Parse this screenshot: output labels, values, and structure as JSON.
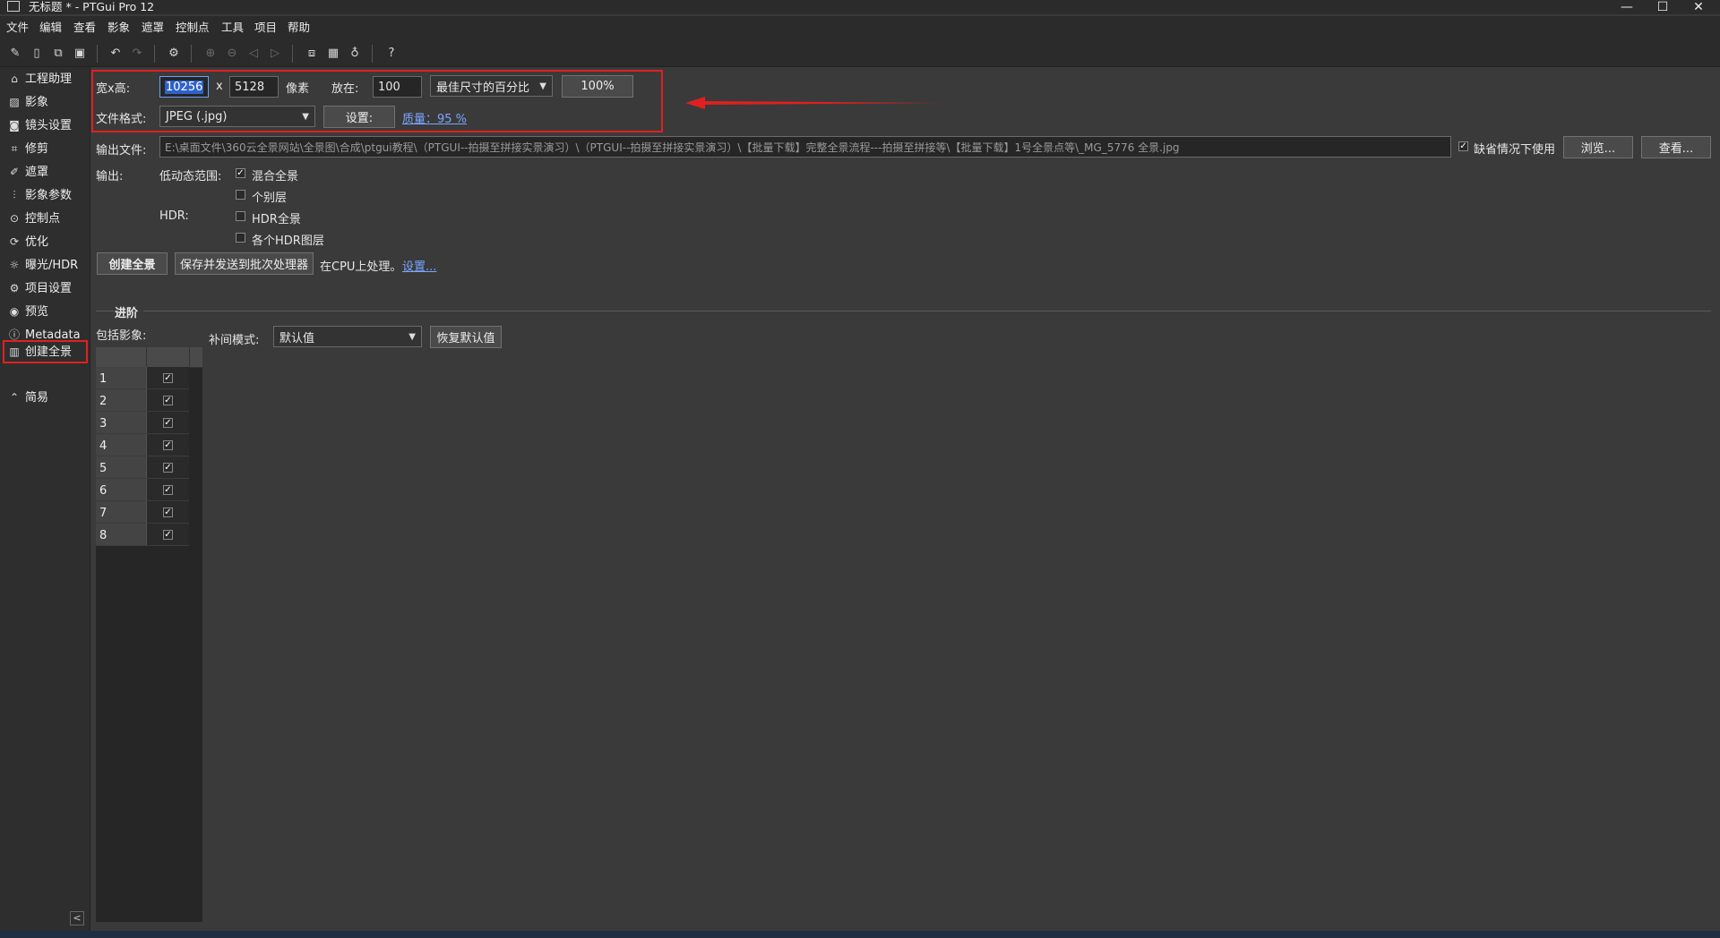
{
  "window": {
    "title": "无标题 * - PTGui Pro 12",
    "controls": {
      "minimize": "—",
      "maximize": "☐",
      "close": "✕"
    }
  },
  "menu": [
    "文件",
    "编辑",
    "查看",
    "影象",
    "遮罩",
    "控制点",
    "工具",
    "项目",
    "帮助"
  ],
  "toolbar": {
    "icons": [
      "new-project-icon",
      "open-icon",
      "copy-icon",
      "save-icon",
      "undo-icon",
      "redo-icon",
      "settings-icon",
      "zoom-in-icon",
      "zoom-out-icon",
      "prev-icon",
      "next-icon",
      "panorama-editor-icon",
      "table-icon",
      "light-icon",
      "help-icon"
    ]
  },
  "sidebar": {
    "items": [
      {
        "label": "工程助理",
        "icon": "home-icon"
      },
      {
        "label": "影象",
        "icon": "image-icon"
      },
      {
        "label": "镜头设置",
        "icon": "camera-icon"
      },
      {
        "label": "修剪",
        "icon": "crop-icon"
      },
      {
        "label": "遮罩",
        "icon": "brush-icon"
      },
      {
        "label": "影象参数",
        "icon": "sliders-icon"
      },
      {
        "label": "控制点",
        "icon": "control-point-icon"
      },
      {
        "label": "优化",
        "icon": "optimize-icon"
      },
      {
        "label": "曝光/HDR",
        "icon": "sun-icon"
      },
      {
        "label": "项目设置",
        "icon": "gear-icon"
      },
      {
        "label": "预览",
        "icon": "eye-icon"
      },
      {
        "label": "Metadata",
        "icon": "info-icon"
      },
      {
        "label": "创建全景",
        "icon": "panorama-icon"
      }
    ],
    "simple_label": "简易",
    "active": "创建全景"
  },
  "size": {
    "label": "宽x高:",
    "width": "10256",
    "x": "x",
    "height": "5128",
    "unit": "像素",
    "at_label": "放在:",
    "at_value": "100",
    "mode": "最佳尺寸的百分比",
    "percent_button": "100%"
  },
  "format": {
    "label": "文件格式:",
    "value": "JPEG (.jpg)",
    "settings_button": "设置:",
    "quality_link": "质量：95 %"
  },
  "output": {
    "file_label": "输出文件:",
    "file_path": "E:\\桌面文件\\360云全景网站\\全景图\\合成\\ptgui教程\\（PTGUI--拍摄至拼接实景演习）\\（PTGUI--拍摄至拼接实景演习）\\【批量下载】完整全景流程---拍摄至拼接等\\【批量下载】1号全景点等\\_MG_5776 全景.jpg",
    "default_checkbox_label": "缺省情况下使用",
    "default_checked": true,
    "browse_button": "浏览...",
    "view_button": "查看...",
    "output_label": "输出:",
    "ldr_label": "低动态范围:",
    "hdr_label": "HDR:",
    "options": [
      {
        "label": "混合全景",
        "checked": true
      },
      {
        "label": "个别层",
        "checked": false
      },
      {
        "label": "HDR全景",
        "checked": false
      },
      {
        "label": "各个HDR图层",
        "checked": false
      }
    ]
  },
  "actions": {
    "create_button": "创建全景",
    "save_batch_button": "保存并发送到批次处理器",
    "cpu_text": "在CPU上处理。",
    "settings_link": "设置..."
  },
  "advanced": {
    "section_label": "进阶",
    "include_label": "包括影象:",
    "interp_label": "补间模式:",
    "interp_value": "默认值",
    "restore_button": "恢复默认值",
    "images": [
      {
        "num": "1",
        "checked": true
      },
      {
        "num": "2",
        "checked": true
      },
      {
        "num": "3",
        "checked": true
      },
      {
        "num": "4",
        "checked": true
      },
      {
        "num": "5",
        "checked": true
      },
      {
        "num": "6",
        "checked": true
      },
      {
        "num": "7",
        "checked": true
      },
      {
        "num": "8",
        "checked": true
      }
    ]
  },
  "colors": {
    "highlight_red": "#e02020",
    "link_blue": "#7aa6ff",
    "selection_blue": "#2f62c9"
  }
}
